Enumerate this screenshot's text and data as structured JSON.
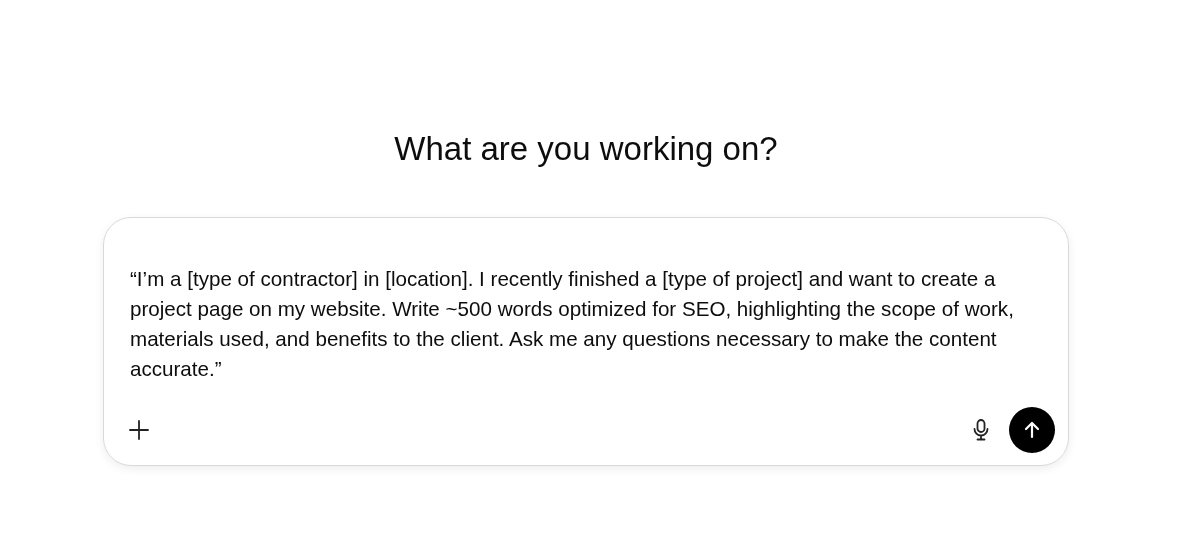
{
  "heading": "What are you working on?",
  "composer": {
    "value": "“I’m a [type of contractor] in [location]. I recently finished a [type of project] and want to create a project page on my website. Write ~500 words optimized for SEO, highlighting the scope of work, materials used, and benefits to the client. Ask me any questions necessary to make the content accurate.”"
  }
}
